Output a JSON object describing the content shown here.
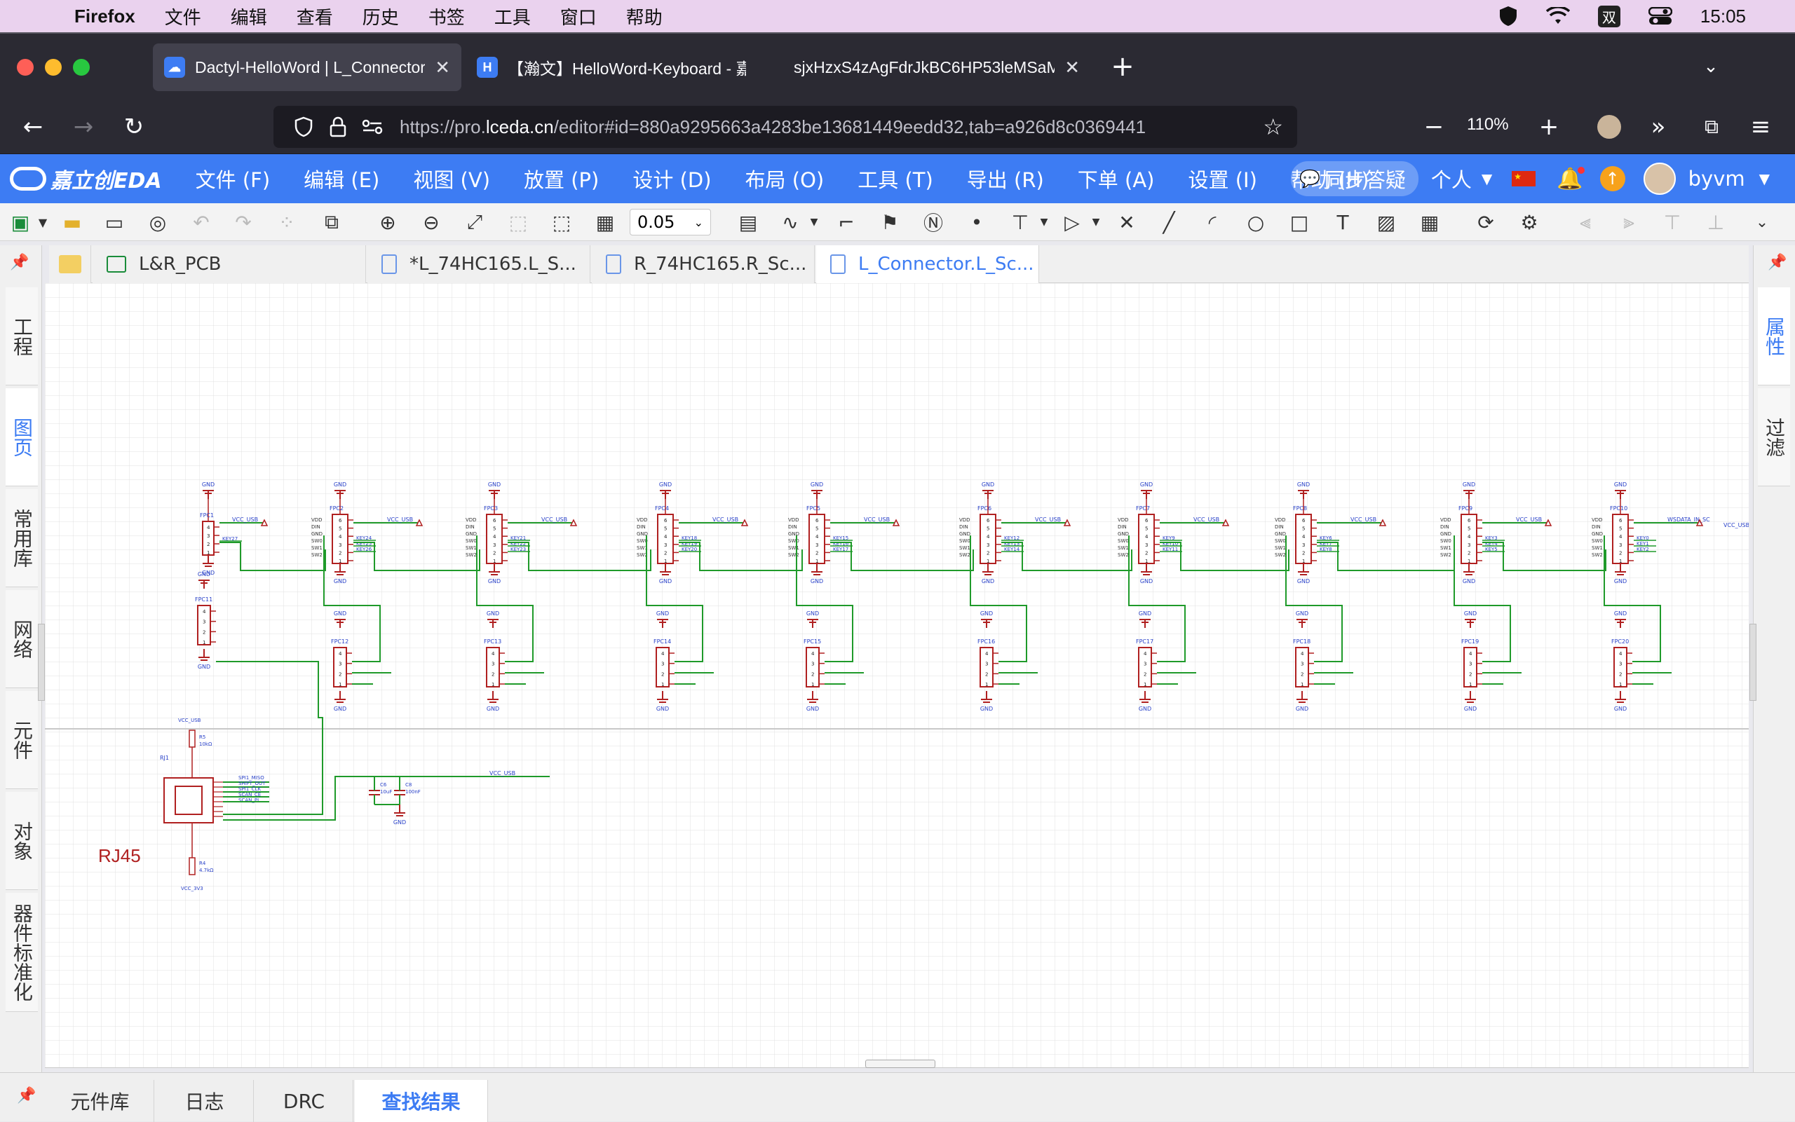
{
  "os_menubar": {
    "app_name": "Firefox",
    "menus": [
      "文件",
      "编辑",
      "查看",
      "历史",
      "书签",
      "工具",
      "窗口",
      "帮助"
    ],
    "input_method": "双",
    "clock": "15:05"
  },
  "browser": {
    "tabs": [
      {
        "title": "Dactyl-HelloWord | L_Connector",
        "active": true
      },
      {
        "title": "【瀚文】HelloWord-Keyboard - 嘉",
        "active": false
      },
      {
        "title": "sjxHzxS4zAgFdrJkBC6HP53leMSaM",
        "active": false
      }
    ],
    "url_prefix": "https://pro.",
    "url_domain": "lceda.cn",
    "url_rest": "/editor#id=880a9295663a4283be13681449eedd32,tab=a926d8c0369441",
    "zoom": "110%"
  },
  "eda": {
    "logo": "嘉立创EDA",
    "menus": [
      "文件 (F)",
      "编辑 (E)",
      "视图 (V)",
      "放置 (P)",
      "设计 (D)",
      "布局 (O)",
      "工具 (T)",
      "导出 (R)",
      "下单 (A)",
      "设置 (I)",
      "帮助 (H)"
    ],
    "collab": "同步答疑",
    "workspace": "个人",
    "username": "byvm",
    "grid_value": "0.05",
    "doc_tabs": [
      {
        "label": "L&R_PCB",
        "active": false
      },
      {
        "label": "*L_74HC165.L_S...",
        "active": false
      },
      {
        "label": "R_74HC165.R_Sc...",
        "active": false
      },
      {
        "label": "L_Connector.L_Sc...",
        "active": true
      }
    ],
    "left_tabs": [
      {
        "label": "工程",
        "active": false
      },
      {
        "label": "图页",
        "active": true
      },
      {
        "label": "常用库",
        "active": false
      },
      {
        "label": "网络",
        "active": false
      },
      {
        "label": "元件",
        "active": false
      },
      {
        "label": "对象",
        "active": false
      },
      {
        "label": "器件标准化",
        "active": false
      }
    ],
    "right_tabs": [
      {
        "label": "属性",
        "active": true
      },
      {
        "label": "过滤",
        "active": false
      }
    ],
    "bottom_tabs": [
      {
        "label": "元件库",
        "active": false
      },
      {
        "label": "日志",
        "active": false
      },
      {
        "label": "DRC",
        "active": false
      },
      {
        "label": "查找结果",
        "active": true
      }
    ]
  },
  "schematic": {
    "rj45_label": "RJ45",
    "rj45_ref": "RJ1",
    "net_gnd": "GND",
    "net_vcc_usb": "VCC_USB",
    "net_vcc_3v3": "VCC_3V3",
    "pin_names": [
      "VDD",
      "DIN",
      "GND",
      "SW0",
      "SW1",
      "SW2"
    ],
    "top_connectors": [
      "FPC1",
      "FPC2",
      "FPC3",
      "FPC4",
      "FPC5",
      "FPC6",
      "FPC7",
      "FPC8",
      "FPC9",
      "FPC10"
    ],
    "bottom_connectors": [
      "FPC11",
      "FPC12",
      "FPC13",
      "FPC14",
      "FPC15",
      "FPC16",
      "FPC17",
      "FPC18",
      "FPC19",
      "FPC20"
    ],
    "key_labels": [
      [
        "KEY27"
      ],
      [
        "KEY24",
        "KEY25",
        "KEY26"
      ],
      [
        "KEY21",
        "KEY22",
        "KEY23"
      ],
      [
        "KEY18",
        "KEY19",
        "KEY20"
      ],
      [
        "KEY15",
        "KEY16",
        "KEY17"
      ],
      [
        "KEY12",
        "KEY13",
        "KEY14"
      ],
      [
        "KEY9",
        "KEY10",
        "KEY11"
      ],
      [
        "KEY6",
        "KEY7",
        "KEY8"
      ],
      [
        "KEY3",
        "KEY4",
        "KEY5"
      ],
      [
        "KEY0",
        "KEY1",
        "KEY2"
      ]
    ],
    "ws_label": "WSDATA_IN_SC",
    "rj45_nets": [
      "SPI1_MISO",
      "SHIFT_OUT",
      "SPI1_CLK",
      "SCAN_CE",
      "SCAN_PL"
    ],
    "r5": [
      "R5",
      "10kΩ"
    ],
    "r4": [
      "R4",
      "4.7kΩ"
    ],
    "c6": [
      "C6",
      "10uF"
    ],
    "c8": [
      "C8",
      "100nF"
    ]
  }
}
